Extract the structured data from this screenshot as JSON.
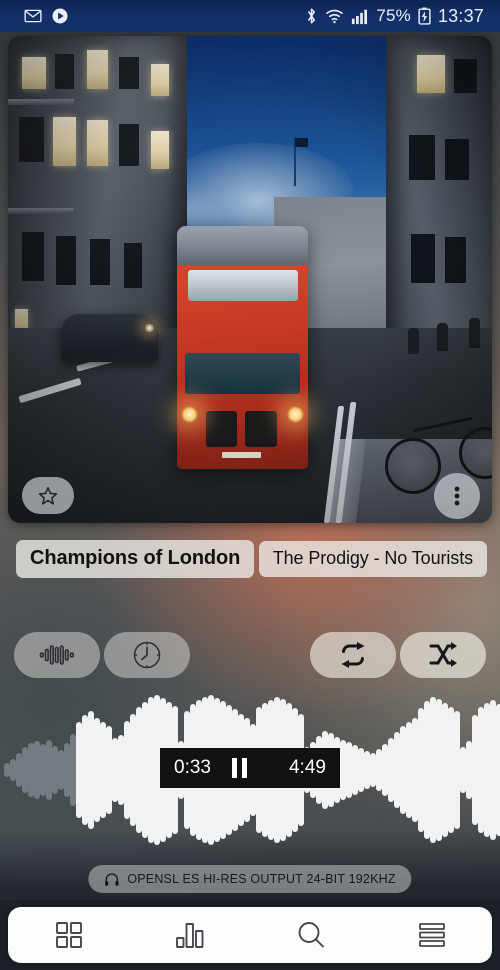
{
  "statusbar": {
    "left_icons": [
      {
        "name": "gmail-icon",
        "label": "M"
      },
      {
        "name": "play-circle-icon",
        "label": ""
      }
    ],
    "right_icons": [
      "bluetooth-icon",
      "wifi-icon",
      "signal-icon",
      "battery-charging-icon"
    ],
    "battery_percent": "75%",
    "clock": "13:37"
  },
  "album_art": {
    "description": "London street at dusk with red double-decker bus",
    "favorite_button": "favorite-star",
    "more_button": "more-options"
  },
  "track": {
    "title": "Champions of London",
    "subtitle": "The Prodigy - No Tourists"
  },
  "controls": [
    {
      "name": "visualizer-button",
      "icon": "waveform-icon",
      "active": false
    },
    {
      "name": "sleep-timer-button",
      "icon": "clock-icon",
      "active": false
    },
    {
      "name": "repeat-button",
      "icon": "repeat-icon",
      "active": true
    },
    {
      "name": "shuffle-button",
      "icon": "shuffle-icon",
      "active": true
    }
  ],
  "player": {
    "current_time": "0:33",
    "total_time": "4:49",
    "state": "playing",
    "transport_icon": "pause-icon",
    "progress_percent": 11.4
  },
  "waveform": {
    "played_bars": 12,
    "heights": [
      14,
      22,
      34,
      46,
      54,
      58,
      52,
      60,
      48,
      40,
      54,
      72,
      96,
      110,
      118,
      104,
      96,
      88,
      64,
      70,
      98,
      112,
      126,
      136,
      146,
      150,
      144,
      136,
      128,
      58,
      118,
      132,
      140,
      146,
      150,
      144,
      138,
      130,
      122,
      112,
      104,
      92,
      126,
      134,
      140,
      146,
      142,
      134,
      124,
      112,
      46,
      56,
      68,
      78,
      74,
      66,
      60,
      56,
      50,
      44,
      38,
      34,
      42,
      52,
      64,
      76,
      88,
      96,
      104,
      124,
      138,
      146,
      142,
      134,
      126,
      118,
      46,
      58,
      110,
      126,
      134,
      140,
      132,
      120,
      40,
      30,
      24,
      18
    ]
  },
  "output_badge": {
    "icon": "headphones-icon",
    "text": "OPENSL ES HI-RES OUTPUT 24-BIT 192KHZ"
  },
  "bottom_nav": [
    {
      "name": "nav-library",
      "icon": "grid-icon"
    },
    {
      "name": "nav-now-playing",
      "icon": "bars-icon",
      "active": true
    },
    {
      "name": "nav-search",
      "icon": "search-icon"
    },
    {
      "name": "nav-queue",
      "icon": "list-icon"
    }
  ],
  "colors": {
    "statusbar": "#123166",
    "bottom_bar": "#1b2127",
    "accent_red": "#c7402f",
    "timebar": "#121212",
    "waveform_upcoming": "#f1f2f2",
    "waveform_played": "#7d848a"
  }
}
